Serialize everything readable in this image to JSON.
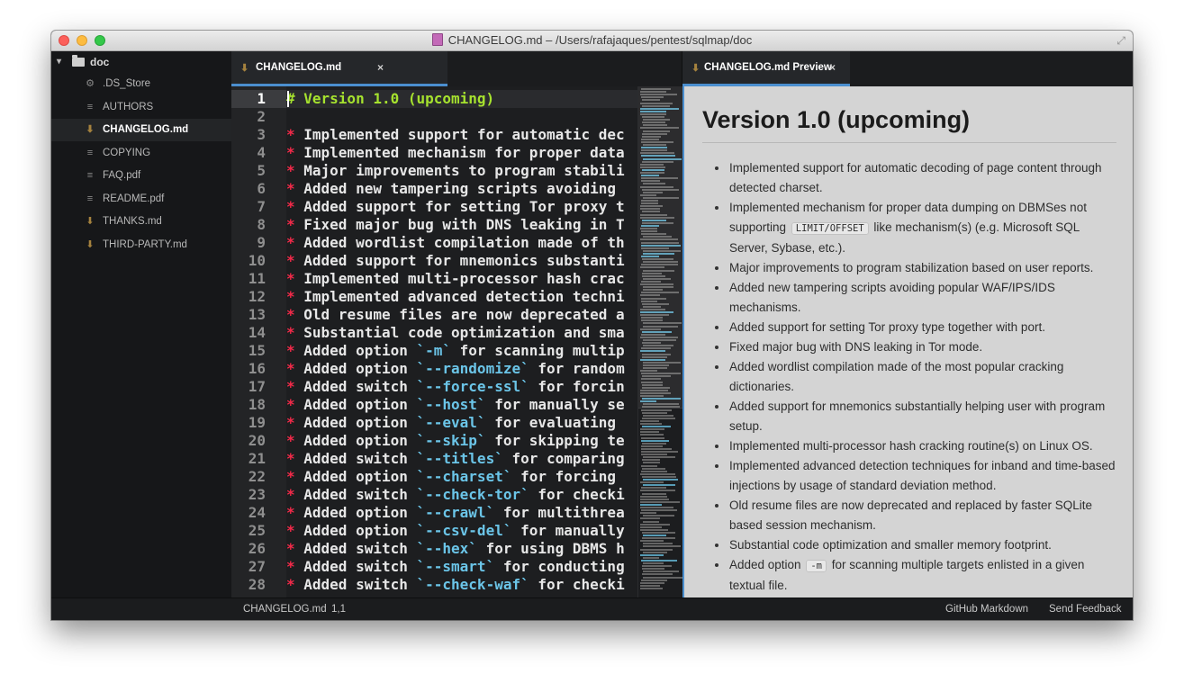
{
  "window": {
    "title": "CHANGELOG.md – /Users/rafajaques/pentest/sqlmap/doc"
  },
  "tree": {
    "root": "doc",
    "items": [
      {
        "icon": "gear-icon",
        "glyph": "⚙",
        "label": ".DS_Store",
        "active": false
      },
      {
        "icon": "text-file-icon",
        "glyph": "≡",
        "label": "AUTHORS",
        "active": false
      },
      {
        "icon": "markdown-icon",
        "glyph": "⬇",
        "label": "CHANGELOG.md",
        "active": true
      },
      {
        "icon": "text-file-icon",
        "glyph": "≡",
        "label": "COPYING",
        "active": false
      },
      {
        "icon": "text-file-icon",
        "glyph": "≡",
        "label": "FAQ.pdf",
        "active": false
      },
      {
        "icon": "text-file-icon",
        "glyph": "≡",
        "label": "README.pdf",
        "active": false
      },
      {
        "icon": "markdown-icon",
        "glyph": "⬇",
        "label": "THANKS.md",
        "active": false
      },
      {
        "icon": "markdown-icon",
        "glyph": "⬇",
        "label": "THIRD-PARTY.md",
        "active": false
      }
    ]
  },
  "editor_tab": {
    "label": "CHANGELOG.md",
    "close": "×"
  },
  "preview_tab": {
    "label": "CHANGELOG.md Preview",
    "close": "×"
  },
  "code_lines": [
    [
      {
        "c": "h",
        "t": "# Version 1.0 (upcoming)"
      }
    ],
    [],
    [
      {
        "c": "b",
        "t": "*"
      },
      {
        "c": "",
        "t": " Implemented support for automatic dec"
      }
    ],
    [
      {
        "c": "b",
        "t": "*"
      },
      {
        "c": "",
        "t": " Implemented mechanism for proper data"
      }
    ],
    [
      {
        "c": "b",
        "t": "*"
      },
      {
        "c": "",
        "t": " Major improvements to program stabili"
      }
    ],
    [
      {
        "c": "b",
        "t": "*"
      },
      {
        "c": "",
        "t": " Added new tampering scripts avoiding "
      }
    ],
    [
      {
        "c": "b",
        "t": "*"
      },
      {
        "c": "",
        "t": " Added support for setting Tor proxy t"
      }
    ],
    [
      {
        "c": "b",
        "t": "*"
      },
      {
        "c": "",
        "t": " Fixed major bug with DNS leaking in T"
      }
    ],
    [
      {
        "c": "b",
        "t": "*"
      },
      {
        "c": "",
        "t": " Added wordlist compilation made of th"
      }
    ],
    [
      {
        "c": "b",
        "t": "*"
      },
      {
        "c": "",
        "t": " Added support for mnemonics substanti"
      }
    ],
    [
      {
        "c": "b",
        "t": "*"
      },
      {
        "c": "",
        "t": " Implemented multi-processor hash crac"
      }
    ],
    [
      {
        "c": "b",
        "t": "*"
      },
      {
        "c": "",
        "t": " Implemented advanced detection techni"
      }
    ],
    [
      {
        "c": "b",
        "t": "*"
      },
      {
        "c": "",
        "t": " Old resume files are now deprecated a"
      }
    ],
    [
      {
        "c": "b",
        "t": "*"
      },
      {
        "c": "",
        "t": " Substantial code optimization and sma"
      }
    ],
    [
      {
        "c": "b",
        "t": "*"
      },
      {
        "c": "",
        "t": " Added option "
      },
      {
        "c": "t",
        "t": "`-m`"
      },
      {
        "c": "",
        "t": " for scanning multip"
      }
    ],
    [
      {
        "c": "b",
        "t": "*"
      },
      {
        "c": "",
        "t": " Added option "
      },
      {
        "c": "t",
        "t": "`--randomize`"
      },
      {
        "c": "",
        "t": " for random"
      }
    ],
    [
      {
        "c": "b",
        "t": "*"
      },
      {
        "c": "",
        "t": " Added switch "
      },
      {
        "c": "t",
        "t": "`--force-ssl`"
      },
      {
        "c": "",
        "t": " for forcin"
      }
    ],
    [
      {
        "c": "b",
        "t": "*"
      },
      {
        "c": "",
        "t": " Added option "
      },
      {
        "c": "t",
        "t": "`--host`"
      },
      {
        "c": "",
        "t": " for manually se"
      }
    ],
    [
      {
        "c": "b",
        "t": "*"
      },
      {
        "c": "",
        "t": " Added option "
      },
      {
        "c": "t",
        "t": "`--eval`"
      },
      {
        "c": "",
        "t": " for evaluating "
      }
    ],
    [
      {
        "c": "b",
        "t": "*"
      },
      {
        "c": "",
        "t": " Added option "
      },
      {
        "c": "t",
        "t": "`--skip`"
      },
      {
        "c": "",
        "t": " for skipping te"
      }
    ],
    [
      {
        "c": "b",
        "t": "*"
      },
      {
        "c": "",
        "t": " Added switch "
      },
      {
        "c": "t",
        "t": "`--titles`"
      },
      {
        "c": "",
        "t": " for comparing"
      }
    ],
    [
      {
        "c": "b",
        "t": "*"
      },
      {
        "c": "",
        "t": " Added option "
      },
      {
        "c": "t",
        "t": "`--charset`"
      },
      {
        "c": "",
        "t": " for forcing "
      }
    ],
    [
      {
        "c": "b",
        "t": "*"
      },
      {
        "c": "",
        "t": " Added switch "
      },
      {
        "c": "t",
        "t": "`--check-tor`"
      },
      {
        "c": "",
        "t": " for checki"
      }
    ],
    [
      {
        "c": "b",
        "t": "*"
      },
      {
        "c": "",
        "t": " Added option "
      },
      {
        "c": "t",
        "t": "`--crawl`"
      },
      {
        "c": "",
        "t": " for multithrea"
      }
    ],
    [
      {
        "c": "b",
        "t": "*"
      },
      {
        "c": "",
        "t": " Added option "
      },
      {
        "c": "t",
        "t": "`--csv-del`"
      },
      {
        "c": "",
        "t": " for manually"
      }
    ],
    [
      {
        "c": "b",
        "t": "*"
      },
      {
        "c": "",
        "t": " Added switch "
      },
      {
        "c": "t",
        "t": "`--hex`"
      },
      {
        "c": "",
        "t": " for using DBMS h"
      }
    ],
    [
      {
        "c": "b",
        "t": "*"
      },
      {
        "c": "",
        "t": " Added switch "
      },
      {
        "c": "t",
        "t": "`--smart`"
      },
      {
        "c": "",
        "t": " for conducting"
      }
    ],
    [
      {
        "c": "b",
        "t": "*"
      },
      {
        "c": "",
        "t": " Added switch "
      },
      {
        "c": "t",
        "t": "`--check-waf`"
      },
      {
        "c": "",
        "t": " for checki"
      }
    ]
  ],
  "preview": {
    "heading": "Version 1.0 (upcoming)",
    "items": [
      [
        {
          "t": "Implemented support for automatic decoding of page content through detected charset."
        }
      ],
      [
        {
          "t": "Implemented mechanism for proper data dumping on DBMSes not supporting "
        },
        {
          "code": "LIMIT/OFFSET"
        },
        {
          "t": " like mechanism(s) (e.g. Microsoft SQL Server, Sybase, etc.)."
        }
      ],
      [
        {
          "t": "Major improvements to program stabilization based on user reports."
        }
      ],
      [
        {
          "t": "Added new tampering scripts avoiding popular WAF/IPS/IDS mechanisms."
        }
      ],
      [
        {
          "t": "Added support for setting Tor proxy type together with port."
        }
      ],
      [
        {
          "t": "Fixed major bug with DNS leaking in Tor mode."
        }
      ],
      [
        {
          "t": "Added wordlist compilation made of the most popular cracking dictionaries."
        }
      ],
      [
        {
          "t": "Added support for mnemonics substantially helping user with program setup."
        }
      ],
      [
        {
          "t": "Implemented multi-processor hash cracking routine(s) on Linux OS."
        }
      ],
      [
        {
          "t": "Implemented advanced detection techniques for inband and time-based injections by usage of standard deviation method."
        }
      ],
      [
        {
          "t": "Old resume files are now deprecated and replaced by faster SQLite based session mechanism."
        }
      ],
      [
        {
          "t": "Substantial code optimization and smaller memory footprint."
        }
      ],
      [
        {
          "t": "Added option "
        },
        {
          "code": "-m"
        },
        {
          "t": " for scanning multiple targets enlisted in a given textual file."
        }
      ]
    ]
  },
  "status": {
    "file": "CHANGELOG.md",
    "position": "1,1",
    "grammar": "GitHub Markdown",
    "feedback": "Send Feedback"
  }
}
